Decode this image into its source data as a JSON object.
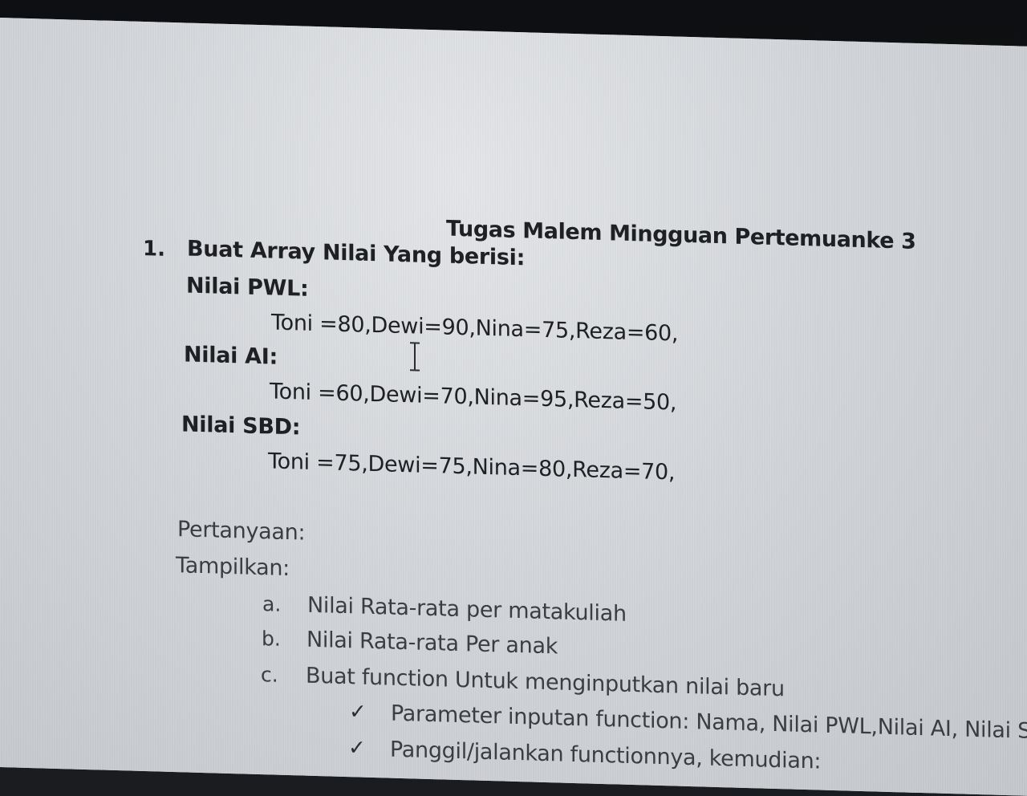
{
  "document": {
    "title": "Tugas Malem Mingguan Pertemuanke 3",
    "item_number": "1.",
    "intro": "Buat Array Nilai Yang berisi:",
    "sections": [
      {
        "label": "Nilai PWL:",
        "values": "Toni =80,Dewi=90,Nina=75,Reza=60,"
      },
      {
        "label": "Nilai AI:",
        "values": "Toni =60,Dewi=70,Nina=95,Reza=50,"
      },
      {
        "label": "Nilai SBD:",
        "values": "Toni =75,Dewi=75,Nina=80,Reza=70,"
      }
    ],
    "question_heading": "Pertanyaan:",
    "display_heading": "Tampilkan:",
    "tasks": [
      {
        "marker": "a.",
        "text": "Nilai Rata-rata per matakuliah"
      },
      {
        "marker": "b.",
        "text": "Nilai Rata-rata Per anak"
      },
      {
        "marker": "c.",
        "text": "Buat function Untuk menginputkan nilai baru"
      }
    ],
    "subtasks": [
      {
        "marker": "✓",
        "text": "Parameter inputan function: Nama, Nilai PWL,Nilai AI, Nilai S"
      },
      {
        "marker": "✓",
        "text": "Panggil/jalankan functionnya, kemudian:"
      }
    ]
  }
}
